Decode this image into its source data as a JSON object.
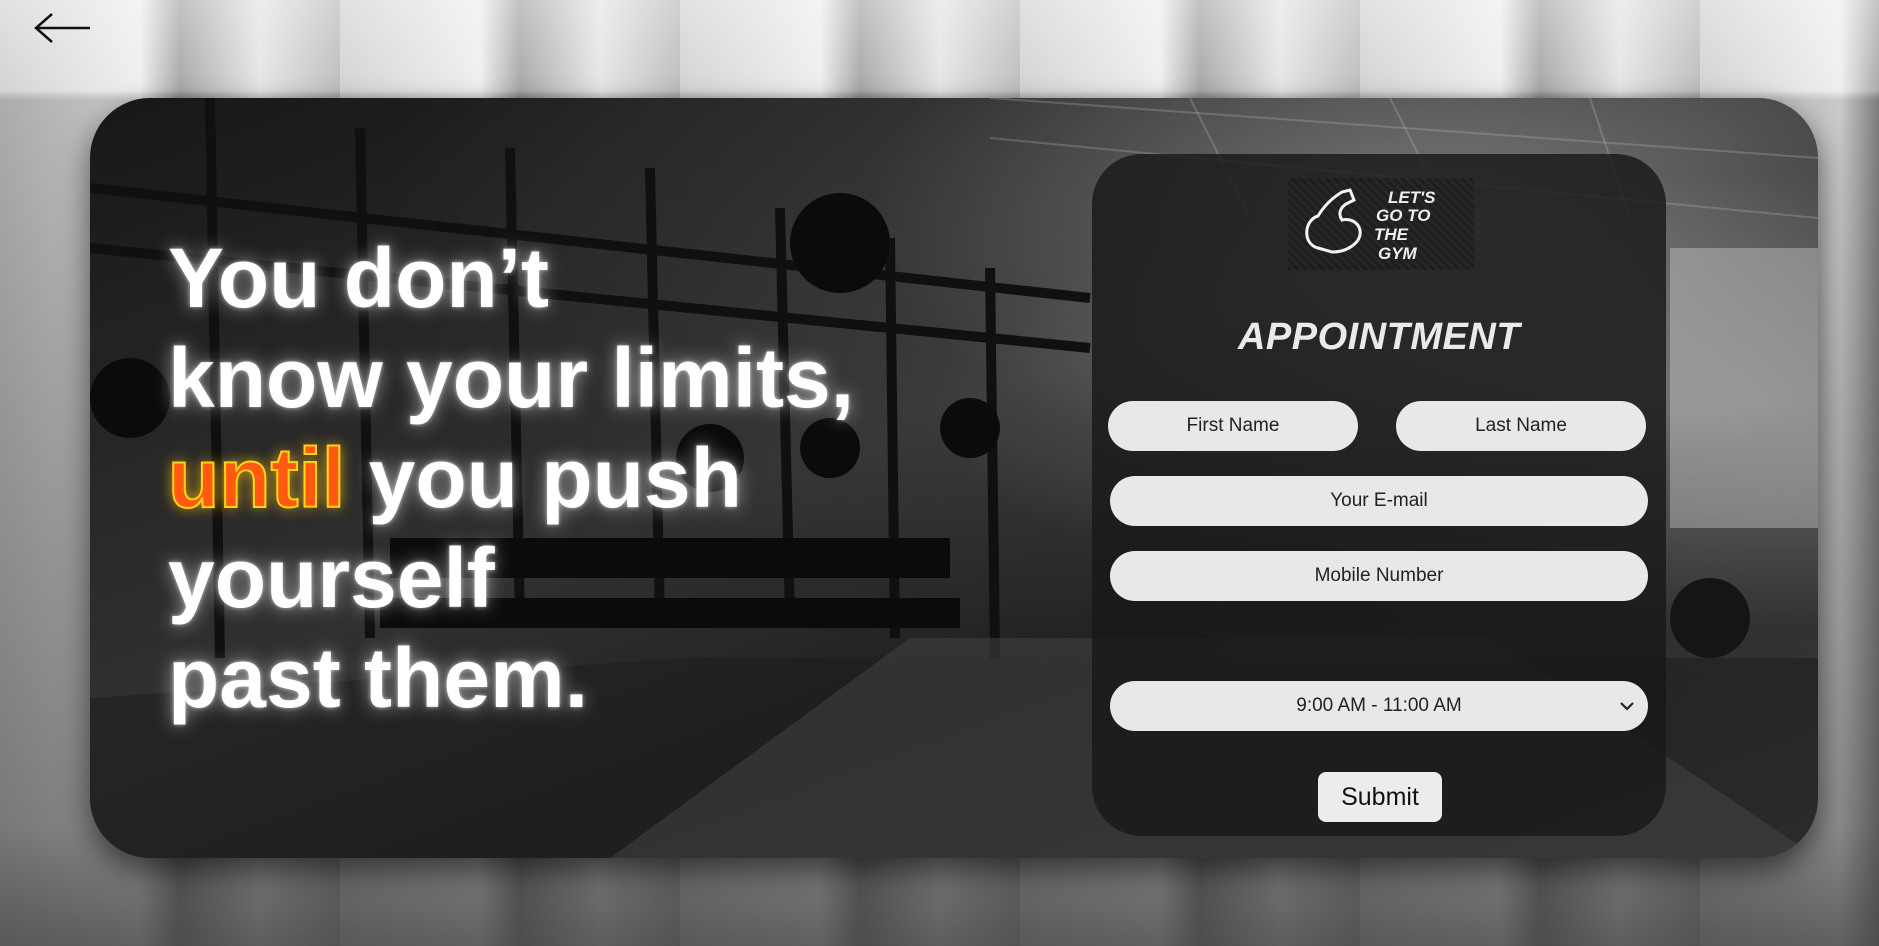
{
  "nav": {
    "back_icon": "arrow-left-icon"
  },
  "hero": {
    "line1": "You don’t",
    "line2": "know your limits,",
    "accent_word": "until",
    "line3_rest": " you push",
    "line4": "yourself",
    "line5": "past them."
  },
  "logo": {
    "icon": "flexed-arm-icon",
    "lines": [
      "LET'S",
      "GO TO",
      "THE",
      "GYM"
    ]
  },
  "form": {
    "title": "APPOINTMENT",
    "first_name_placeholder": "First Name",
    "last_name_placeholder": "Last Name",
    "email_placeholder": "Your E-mail",
    "mobile_placeholder": "Mobile Number",
    "time_slot_selected": "9:00 AM - 11:00 AM",
    "submit_label": "Submit"
  },
  "colors": {
    "accent_fill": "#ff5a10",
    "accent_stroke": "#ffd21a",
    "panel": "#181818",
    "field": "#e8e8e8"
  }
}
